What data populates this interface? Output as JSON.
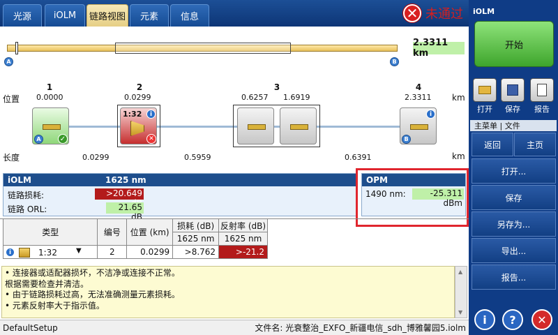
{
  "tabs": [
    "光源",
    "iOLM",
    "链路视图",
    "元素",
    "信息"
  ],
  "status": {
    "fail_text": "未通过"
  },
  "overview": {
    "total_length": "2.3311 km",
    "marker_a": "A",
    "marker_b": "B",
    "row_position_label": "位置",
    "row_length_label": "长度",
    "unit": "km",
    "event_numbers": [
      "1",
      "2",
      "3",
      "4"
    ],
    "positions": [
      "0.0000",
      "0.0299",
      "0.6257",
      "1.6919",
      "2.3311"
    ],
    "lengths": [
      "0.0299",
      "0.5959",
      "0.6391"
    ],
    "event2_ratio": "1:32"
  },
  "iolm_panel": {
    "title": "iOLM",
    "wavelength": "1625 nm",
    "link_loss_label": "链路损耗:",
    "link_loss_value": ">20.649 dB",
    "link_orl_label": "链路 ORL:",
    "link_orl_value": "21.65 dB"
  },
  "opm_panel": {
    "title": "OPM",
    "wavelength_label": "1490 nm:",
    "power_value": "-25.311 dBm"
  },
  "event_table": {
    "headers": [
      "类型",
      "编号",
      "位置 (km)",
      "损耗 (dB)",
      "反射率 (dB)"
    ],
    "subheaders": [
      "1625 nm",
      "1625 nm"
    ],
    "row": {
      "type": "1:32",
      "number": "2",
      "position": "0.0299",
      "loss": ">8.762",
      "reflectance": ">-21.2"
    }
  },
  "messages": [
    "• 连接器或适配器损坏，不洁净或连接不正常。",
    "根据需要检查并清洁。",
    "• 由于链路损耗过高，无法准确测量元素损耗。",
    "• 元素反射率大于指示值。"
  ],
  "statusbar": {
    "setup": "DefaultSetup",
    "filename": "文件名: 光衰整治_EXFO_新疆电信_sdh_博雅馨园5.iolm"
  },
  "sidebar": {
    "title": "iOLM",
    "start": "开始",
    "open_icon_label": "打开",
    "save_icon_label": "保存",
    "report_icon_label": "报告",
    "menu_header": "主菜单 | 文件",
    "back": "返回",
    "home": "主页",
    "menu_items": [
      "打开...",
      "保存",
      "另存为...",
      "导出...",
      "报告..."
    ]
  },
  "colors": {
    "fail": "#d41f1f",
    "loss_bad": "#b31b1b",
    "good": "#bff0a8",
    "accent": "#0f3c86"
  }
}
